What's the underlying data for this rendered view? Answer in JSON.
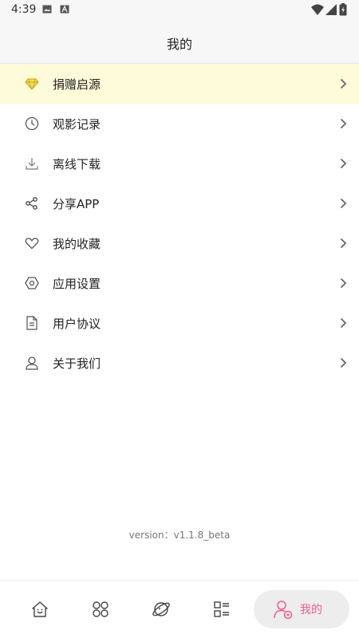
{
  "status_bar": {
    "time": "4:39",
    "icons": [
      "image-icon",
      "text-a-icon",
      "wifi-icon",
      "signal-icon",
      "battery-charging-icon"
    ]
  },
  "header": {
    "title": "我的"
  },
  "menu": {
    "items": [
      {
        "label": "捐赠启源",
        "icon": "diamond-icon",
        "highlighted": true
      },
      {
        "label": "观影记录",
        "icon": "clock-icon"
      },
      {
        "label": "离线下载",
        "icon": "download-icon"
      },
      {
        "label": "分享APP",
        "icon": "share-icon"
      },
      {
        "label": "我的收藏",
        "icon": "heart-icon"
      },
      {
        "label": "应用设置",
        "icon": "settings-icon"
      },
      {
        "label": "用户协议",
        "icon": "document-icon"
      },
      {
        "label": "关于我们",
        "icon": "user-icon"
      }
    ]
  },
  "version_text": "version：v1.1.8_beta",
  "bottom_nav": {
    "items": [
      {
        "icon": "home-icon"
      },
      {
        "icon": "category-icon"
      },
      {
        "icon": "planet-icon"
      },
      {
        "icon": "list-icon"
      },
      {
        "icon": "profile-icon",
        "label": "我的",
        "active": true
      }
    ]
  },
  "colors": {
    "accent": "#f15b8c",
    "highlight_row": "#fdfbd9",
    "header_bg": "#f7f7f7",
    "active_tab_bg": "#ededed",
    "diamond": "#e8c632"
  }
}
